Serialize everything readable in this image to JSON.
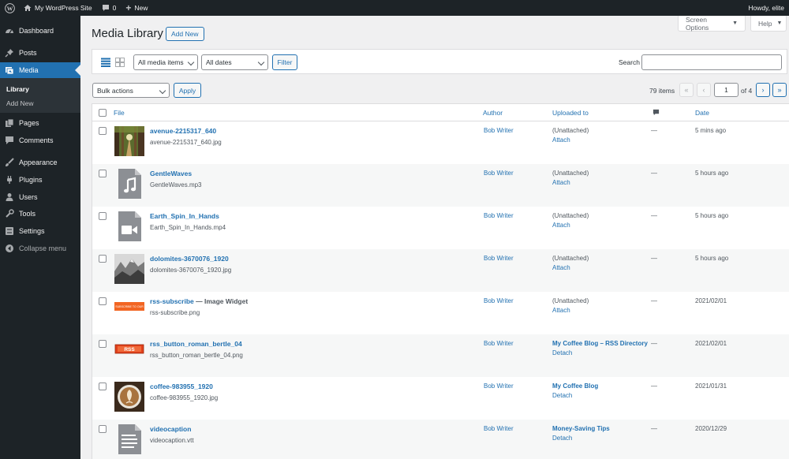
{
  "adminbar": {
    "site_name": "My WordPress Site",
    "comments_count": "0",
    "new_label": "New",
    "greeting": "Howdy, elite"
  },
  "menu": {
    "dashboard": "Dashboard",
    "posts": "Posts",
    "media": "Media",
    "library": "Library",
    "add_new": "Add New",
    "pages": "Pages",
    "comments": "Comments",
    "appearance": "Appearance",
    "plugins": "Plugins",
    "users": "Users",
    "tools": "Tools",
    "settings": "Settings",
    "collapse": "Collapse menu"
  },
  "screen_options": "Screen Options",
  "help": "Help",
  "page": {
    "title": "Media Library",
    "add_new": "Add New"
  },
  "filters": {
    "media_type": "All media items",
    "dates": "All dates",
    "filter_button": "Filter",
    "search_label": "Search"
  },
  "tablenav": {
    "bulk_actions": "Bulk actions",
    "apply": "Apply",
    "items_count": "79 items",
    "first": "«",
    "prev": "‹",
    "current_page": "1",
    "of_pages": "of 4",
    "next": "›",
    "last": "»"
  },
  "columns": {
    "file": "File",
    "author": "Author",
    "uploaded_to": "Uploaded to",
    "date": "Date"
  },
  "rows": [
    {
      "title": "avenue-2215317_640",
      "suffix": "",
      "filename": "avenue-2215317_640.jpg",
      "author": "Bob Writer",
      "uploaded": "(Unattached)",
      "action": "Attach",
      "comments": "—",
      "date": "5 mins ago",
      "thumb": "forest-photo"
    },
    {
      "title": "GentleWaves",
      "suffix": "",
      "filename": "GentleWaves.mp3",
      "author": "Bob Writer",
      "uploaded": "(Unattached)",
      "action": "Attach",
      "comments": "—",
      "date": "5 hours ago",
      "thumb": "audio-file-icon"
    },
    {
      "title": "Earth_Spin_In_Hands",
      "suffix": "",
      "filename": "Earth_Spin_In_Hands.mp4",
      "author": "Bob Writer",
      "uploaded": "(Unattached)",
      "action": "Attach",
      "comments": "—",
      "date": "5 hours ago",
      "thumb": "video-file-icon"
    },
    {
      "title": "dolomites-3670076_1920",
      "suffix": "",
      "filename": "dolomites-3670076_1920.jpg",
      "author": "Bob Writer",
      "uploaded": "(Unattached)",
      "action": "Attach",
      "comments": "—",
      "date": "5 hours ago",
      "thumb": "mountain-photo"
    },
    {
      "title": "rss-subscribe",
      "suffix": " — Image Widget",
      "filename": "rss-subscribe.png",
      "author": "Bob Writer",
      "uploaded": "(Unattached)",
      "action": "Attach",
      "comments": "—",
      "date": "2021/02/01",
      "thumb": "rss-subscribe-banner"
    },
    {
      "title": "rss_button_roman_bertle_04",
      "suffix": "",
      "filename": "rss_button_roman_bertle_04.png",
      "author": "Bob Writer",
      "uploaded": "My Coffee Blog – RSS Directory",
      "action": "Detach",
      "comments": "—",
      "date": "2021/02/01",
      "thumb": "rss-button-image"
    },
    {
      "title": "coffee-983955_1920",
      "suffix": "",
      "filename": "coffee-983955_1920.jpg",
      "author": "Bob Writer",
      "uploaded": "My Coffee Blog",
      "action": "Detach",
      "comments": "—",
      "date": "2021/01/31",
      "thumb": "coffee-photo"
    },
    {
      "title": "videocaption",
      "suffix": "",
      "filename": "videocaption.vtt",
      "author": "Bob Writer",
      "uploaded": "Money-Saving Tips",
      "action": "Detach",
      "comments": "—",
      "date": "2020/12/29",
      "thumb": "document-file-icon"
    }
  ],
  "colors": {
    "admin_bar": "#1d2327",
    "menu_current": "#2271b1",
    "link": "#2271b1",
    "page_bg": "#f0f0f1"
  },
  "thumb_text": {
    "rss_subscribe": "SUBSCRIBE TO OUR",
    "rss_button": "RSS"
  }
}
